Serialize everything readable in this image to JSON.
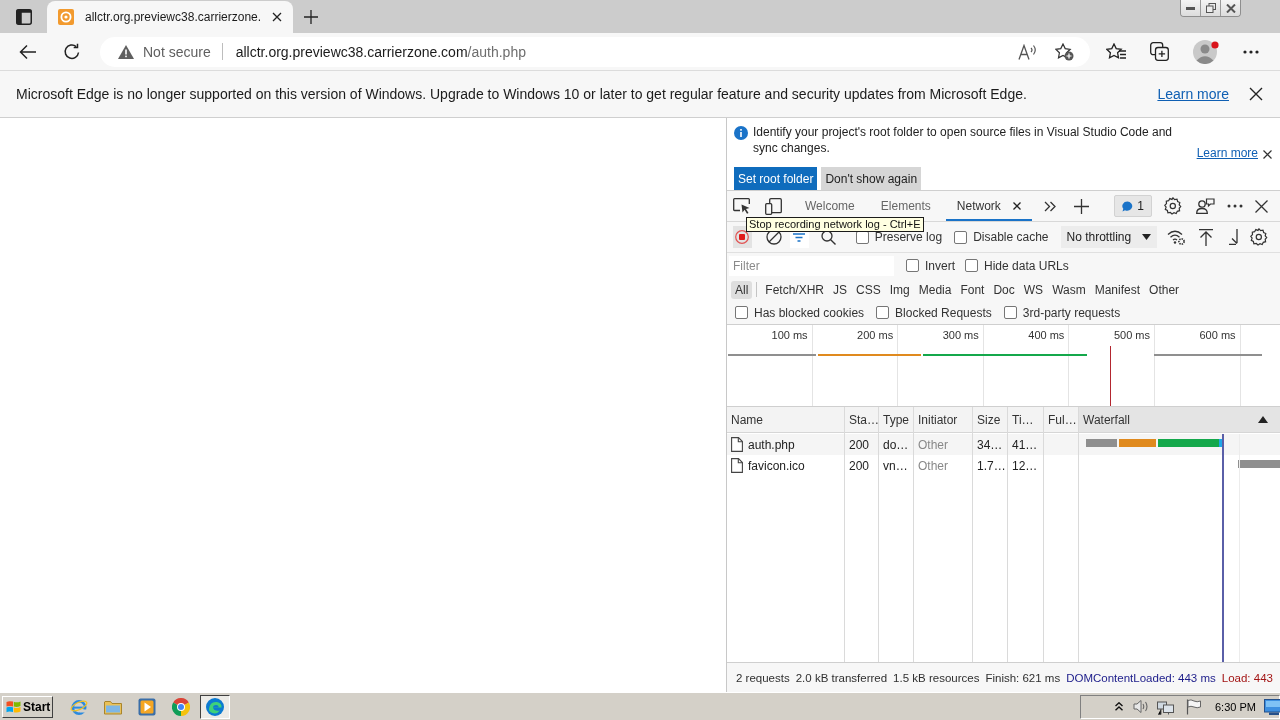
{
  "browser": {
    "tabs": [
      {
        "title": "allctr.org.previewc38.carrierzone.",
        "selected": true
      }
    ],
    "address": {
      "security": "Not secure",
      "host": "allctr.org.previewc38.carrierzone.com",
      "path": "/auth.php"
    },
    "profile": {
      "notification": true
    }
  },
  "banner": {
    "message": "Microsoft Edge is no longer supported on this version of Windows. Upgrade to Windows 10 or later to get regular feature and security updates from Microsoft Edge.",
    "link": "Learn more"
  },
  "devtools": {
    "infobar": {
      "message": "Identify your project's root folder to open source files in Visual Studio Code and sync changes.",
      "link": "Learn more",
      "buttons": [
        {
          "label": "Set root folder",
          "kind": "primary"
        },
        {
          "label": "Don't show again",
          "kind": "secondary"
        }
      ]
    },
    "tabs": [
      {
        "label": "Welcome",
        "selected": false,
        "closable": false
      },
      {
        "label": "Elements",
        "selected": false,
        "closable": false
      },
      {
        "label": "Network",
        "selected": true,
        "closable": true
      }
    ],
    "issues_count": "1",
    "toolbar": {
      "recording": true,
      "filter_open": true,
      "checkboxes": [
        {
          "label": "Preserve log",
          "checked": false
        },
        {
          "label": "Disable cache",
          "checked": false
        }
      ],
      "throttling": "No throttling"
    },
    "tooltip": "Stop recording network log - Ctrl+E",
    "filter": {
      "placeholder": "Filter",
      "checkboxes": [
        {
          "label": "Invert",
          "checked": false
        },
        {
          "label": "Hide data URLs",
          "checked": false
        }
      ]
    },
    "types": [
      {
        "label": "All",
        "selected": true
      },
      {
        "label": "Fetch/XHR",
        "selected": false
      },
      {
        "label": "JS",
        "selected": false
      },
      {
        "label": "CSS",
        "selected": false
      },
      {
        "label": "Img",
        "selected": false
      },
      {
        "label": "Media",
        "selected": false
      },
      {
        "label": "Font",
        "selected": false
      },
      {
        "label": "Doc",
        "selected": false
      },
      {
        "label": "WS",
        "selected": false
      },
      {
        "label": "Wasm",
        "selected": false
      },
      {
        "label": "Manifest",
        "selected": false
      },
      {
        "label": "Other",
        "selected": false
      }
    ],
    "options": [
      {
        "label": "Has blocked cookies",
        "checked": false
      },
      {
        "label": "Blocked Requests",
        "checked": false
      },
      {
        "label": "3rd-party requests",
        "checked": false
      }
    ],
    "overview": {
      "ticks": [
        "100 ms",
        "200 ms",
        "300 ms",
        "400 ms",
        "500 ms",
        "600 ms"
      ]
    },
    "table": {
      "columns": [
        {
          "label": "Name",
          "sorted": false
        },
        {
          "label": "Sta…",
          "sorted": false
        },
        {
          "label": "Type",
          "sorted": false
        },
        {
          "label": "Initiator",
          "sorted": false
        },
        {
          "label": "Size",
          "sorted": false
        },
        {
          "label": "Ti…",
          "sorted": false
        },
        {
          "label": "Ful…",
          "sorted": false
        },
        {
          "label": "Waterfall",
          "sorted": true
        }
      ],
      "rows": [
        {
          "name": "auth.php",
          "status": "200",
          "type": "do…",
          "initiator": "Other",
          "size": "34…",
          "time": "41…"
        },
        {
          "name": "favicon.ico",
          "status": "200",
          "type": "vn…",
          "initiator": "Other",
          "size": "1.7…",
          "time": "12…"
        }
      ]
    },
    "summary": [
      {
        "text": "2 requests",
        "kind": "plain"
      },
      {
        "text": "2.0 kB transferred",
        "kind": "plain"
      },
      {
        "text": "1.5 kB resources",
        "kind": "plain"
      },
      {
        "text": "Finish: 621 ms",
        "kind": "plain"
      },
      {
        "text": "DOMContentLoaded: 443 ms",
        "kind": "dom"
      },
      {
        "text": "Load: 443",
        "kind": "load"
      }
    ]
  },
  "taskbar": {
    "start": "Start",
    "apps": [
      {
        "kind": "e-globe",
        "selected": false
      },
      {
        "kind": "folder",
        "selected": false
      },
      {
        "kind": "player",
        "selected": false
      },
      {
        "kind": "tricolor",
        "selected": false
      },
      {
        "kind": "swirl",
        "selected": true
      }
    ],
    "clock": "6:30 PM"
  }
}
